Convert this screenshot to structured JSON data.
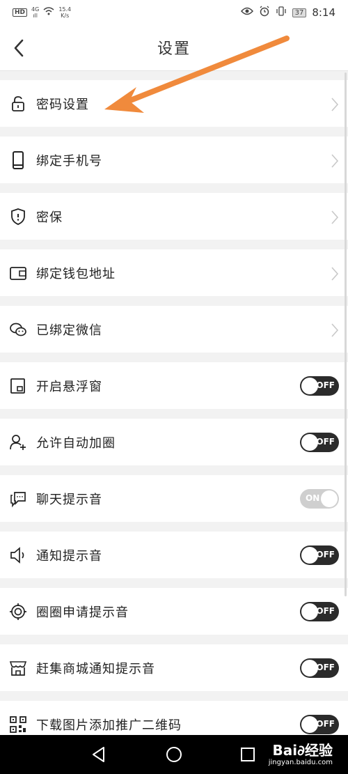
{
  "status_bar": {
    "hd": "HD",
    "net_top": "4G",
    "net_bottom": "ıll",
    "speed_value": "15.4",
    "speed_unit": "K/s",
    "battery": "37",
    "time": "8:14"
  },
  "header": {
    "title": "设置"
  },
  "rows": [
    {
      "label": "密码设置",
      "icon": "lock-icon",
      "control": "chevron"
    },
    {
      "label": "绑定手机号",
      "icon": "phone-icon",
      "control": "chevron"
    },
    {
      "label": "密保",
      "icon": "shield-icon",
      "control": "chevron"
    },
    {
      "label": "绑定钱包地址",
      "icon": "wallet-icon",
      "control": "chevron"
    },
    {
      "label": "已绑定微信",
      "icon": "wechat-icon",
      "control": "chevron"
    },
    {
      "label": "开启悬浮窗",
      "icon": "floating-window-icon",
      "control": "toggle",
      "state": "OFF"
    },
    {
      "label": "允许自动加圈",
      "icon": "add-user-icon",
      "control": "toggle",
      "state": "OFF"
    },
    {
      "label": "聊天提示音",
      "icon": "chat-icon",
      "control": "toggle",
      "state": "ON"
    },
    {
      "label": "通知提示音",
      "icon": "speaker-icon",
      "control": "toggle",
      "state": "OFF"
    },
    {
      "label": "圈圈申请提示音",
      "icon": "target-icon",
      "control": "toggle",
      "state": "OFF"
    },
    {
      "label": "赶集商城通知提示音",
      "icon": "store-icon",
      "control": "toggle",
      "state": "OFF"
    },
    {
      "label": "下载图片添加推广二维码",
      "icon": "qr-code-icon",
      "control": "toggle",
      "state": "OFF"
    }
  ],
  "watermark": {
    "brand": "Bai∂经验",
    "url": "jingyan.baidu.com"
  },
  "colors": {
    "arrow": "#f08a3c",
    "toggle_off": "#2b2b2b",
    "toggle_on": "#cfcfcf"
  }
}
